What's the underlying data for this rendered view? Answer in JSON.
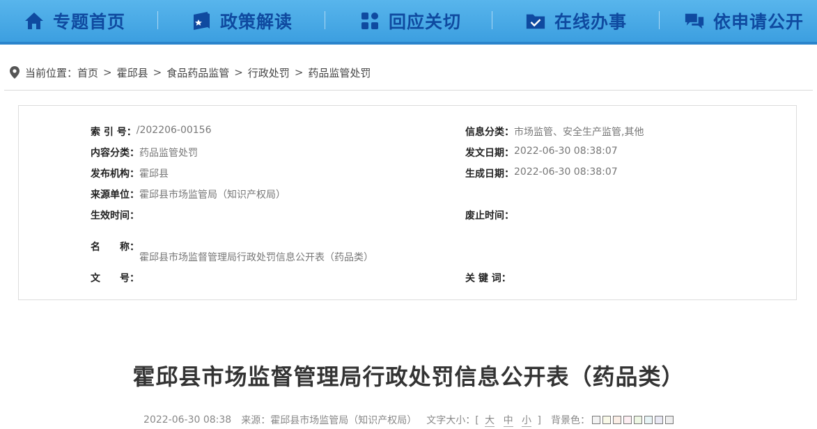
{
  "nav": {
    "items": [
      {
        "label": "专题首页",
        "icon": "home-icon"
      },
      {
        "label": "政策解读",
        "icon": "book-icon"
      },
      {
        "label": "回应关切",
        "icon": "grid-icon"
      },
      {
        "label": "在线办事",
        "icon": "folder-check-icon"
      },
      {
        "label": "依申请公开",
        "icon": "chat-icon"
      }
    ]
  },
  "breadcrumb": {
    "prefix": "当前位置：",
    "items": [
      "首页",
      "霍邱县",
      "食品药品监管",
      "行政处罚",
      "药品监管处罚"
    ]
  },
  "info": {
    "index_no": {
      "key": "索 引 号：",
      "value": "/202206-00156"
    },
    "category": {
      "key": "信息分类：",
      "value": "市场监管、安全生产监管,其他"
    },
    "content_type": {
      "key": "内容分类：",
      "value": "药品监管处罚"
    },
    "issue_date": {
      "key": "发文日期：",
      "value": "2022-06-30 08:38:07"
    },
    "publisher": {
      "key": "发布机构：",
      "value": "霍邱县"
    },
    "created_date": {
      "key": "生成日期：",
      "value": "2022-06-30 08:38:07"
    },
    "source_unit": {
      "key": "来源单位：",
      "value": "霍邱县市场监管局（知识产权局）"
    },
    "effective_time": {
      "key": "生效时间：",
      "value": ""
    },
    "expiry_time": {
      "key": "废止时间：",
      "value": ""
    },
    "name": {
      "key": "名　　称：",
      "value": "霍邱县市场监督管理局行政处罚信息公开表（药品类）"
    },
    "doc_no": {
      "key": "文　　号：",
      "value": ""
    },
    "keywords": {
      "key": "关 键 词：",
      "value": ""
    }
  },
  "article": {
    "title": "霍邱县市场监督管理局行政处罚信息公开表（药品类）",
    "date": "2022-06-30 08:38",
    "source_label": "来源：霍邱县市场监管局（知识产权局）",
    "font_size_label": "文字大小：[",
    "font_sizes": [
      "大",
      "中",
      "小"
    ],
    "font_size_end": "]",
    "bg_label": "背景色：",
    "bg_colors": [
      "#f3f3f3",
      "#f9f9e8",
      "#fbeee6",
      "#fdeef2",
      "#eef7e4",
      "#e7f4f6",
      "#e9e9f4",
      "#eeeeee"
    ]
  }
}
